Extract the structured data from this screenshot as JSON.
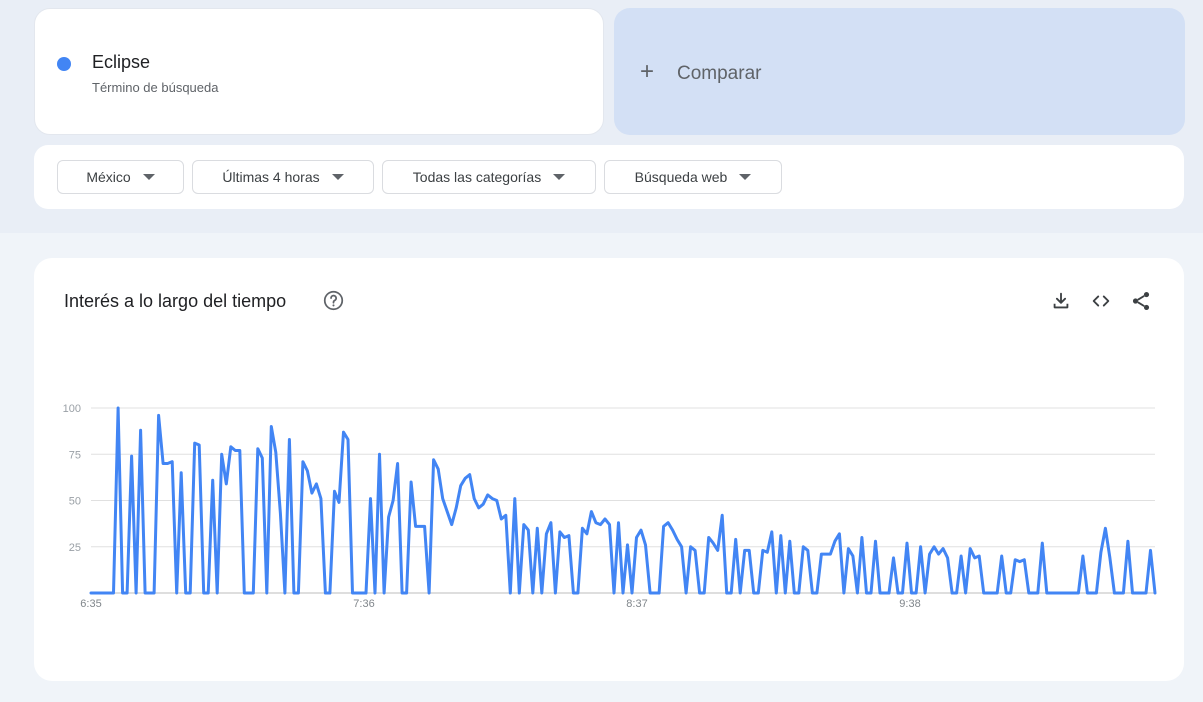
{
  "search_term": {
    "name": "Eclipse",
    "subtitle": "Término de búsqueda",
    "color": "#4285f4"
  },
  "compare": {
    "label": "Comparar"
  },
  "filters": [
    {
      "label": "México"
    },
    {
      "label": "Últimas 4 horas"
    },
    {
      "label": "Todas las categorías"
    },
    {
      "label": "Búsqueda web"
    }
  ],
  "chart_panel": {
    "title": "Interés a lo largo del tiempo",
    "icons": [
      "help-icon",
      "download-icon",
      "embed-icon",
      "share-icon"
    ]
  },
  "chart_data": {
    "type": "line",
    "x_tick_labels": [
      "6:35",
      "7:36",
      "8:37",
      "9:38"
    ],
    "y_ticks": [
      100,
      75,
      50,
      25
    ],
    "ylim": [
      0,
      100
    ],
    "grid": true,
    "line_color": "#4285f4",
    "values": [
      0,
      0,
      0,
      0,
      0,
      0,
      100,
      0,
      0,
      74,
      0,
      88,
      0,
      0,
      0,
      96,
      70,
      70,
      71,
      0,
      65,
      0,
      0,
      81,
      80,
      0,
      0,
      61,
      0,
      75,
      59,
      79,
      77,
      77,
      0,
      0,
      0,
      78,
      73,
      0,
      90,
      76,
      43,
      0,
      83,
      0,
      0,
      71,
      66,
      54,
      59,
      51,
      0,
      0,
      55,
      49,
      87,
      83,
      0,
      0,
      0,
      0,
      51,
      0,
      75,
      0,
      41,
      50,
      70,
      0,
      0,
      60,
      36,
      36,
      36,
      0,
      72,
      67,
      51,
      44,
      37,
      46,
      58,
      62,
      64,
      51,
      46,
      48,
      53,
      51,
      50,
      40,
      42,
      0,
      51,
      0,
      37,
      34,
      0,
      35,
      0,
      32,
      38,
      0,
      33,
      30,
      31,
      0,
      0,
      35,
      32,
      44,
      38,
      37,
      40,
      37,
      0,
      38,
      0,
      26,
      0,
      30,
      34,
      26,
      0,
      0,
      0,
      36,
      38,
      34,
      29,
      25,
      0,
      25,
      23,
      0,
      0,
      30,
      27,
      23,
      42,
      0,
      0,
      29,
      0,
      23,
      23,
      0,
      0,
      23,
      22,
      33,
      0,
      31,
      0,
      28,
      0,
      0,
      25,
      23,
      0,
      0,
      21,
      21,
      21,
      28,
      32,
      0,
      24,
      20,
      0,
      30,
      0,
      0,
      28,
      0,
      0,
      0,
      19,
      0,
      0,
      27,
      0,
      0,
      25,
      0,
      21,
      25,
      21,
      24,
      19,
      0,
      0,
      20,
      0,
      24,
      19,
      20,
      0,
      0,
      0,
      0,
      20,
      0,
      0,
      18,
      17,
      18,
      0,
      0,
      0,
      27,
      0,
      0,
      0,
      0,
      0,
      0,
      0,
      0,
      20,
      0,
      0,
      0,
      22,
      35,
      19,
      0,
      0,
      0,
      28,
      0,
      0,
      0,
      0,
      23,
      0
    ]
  }
}
